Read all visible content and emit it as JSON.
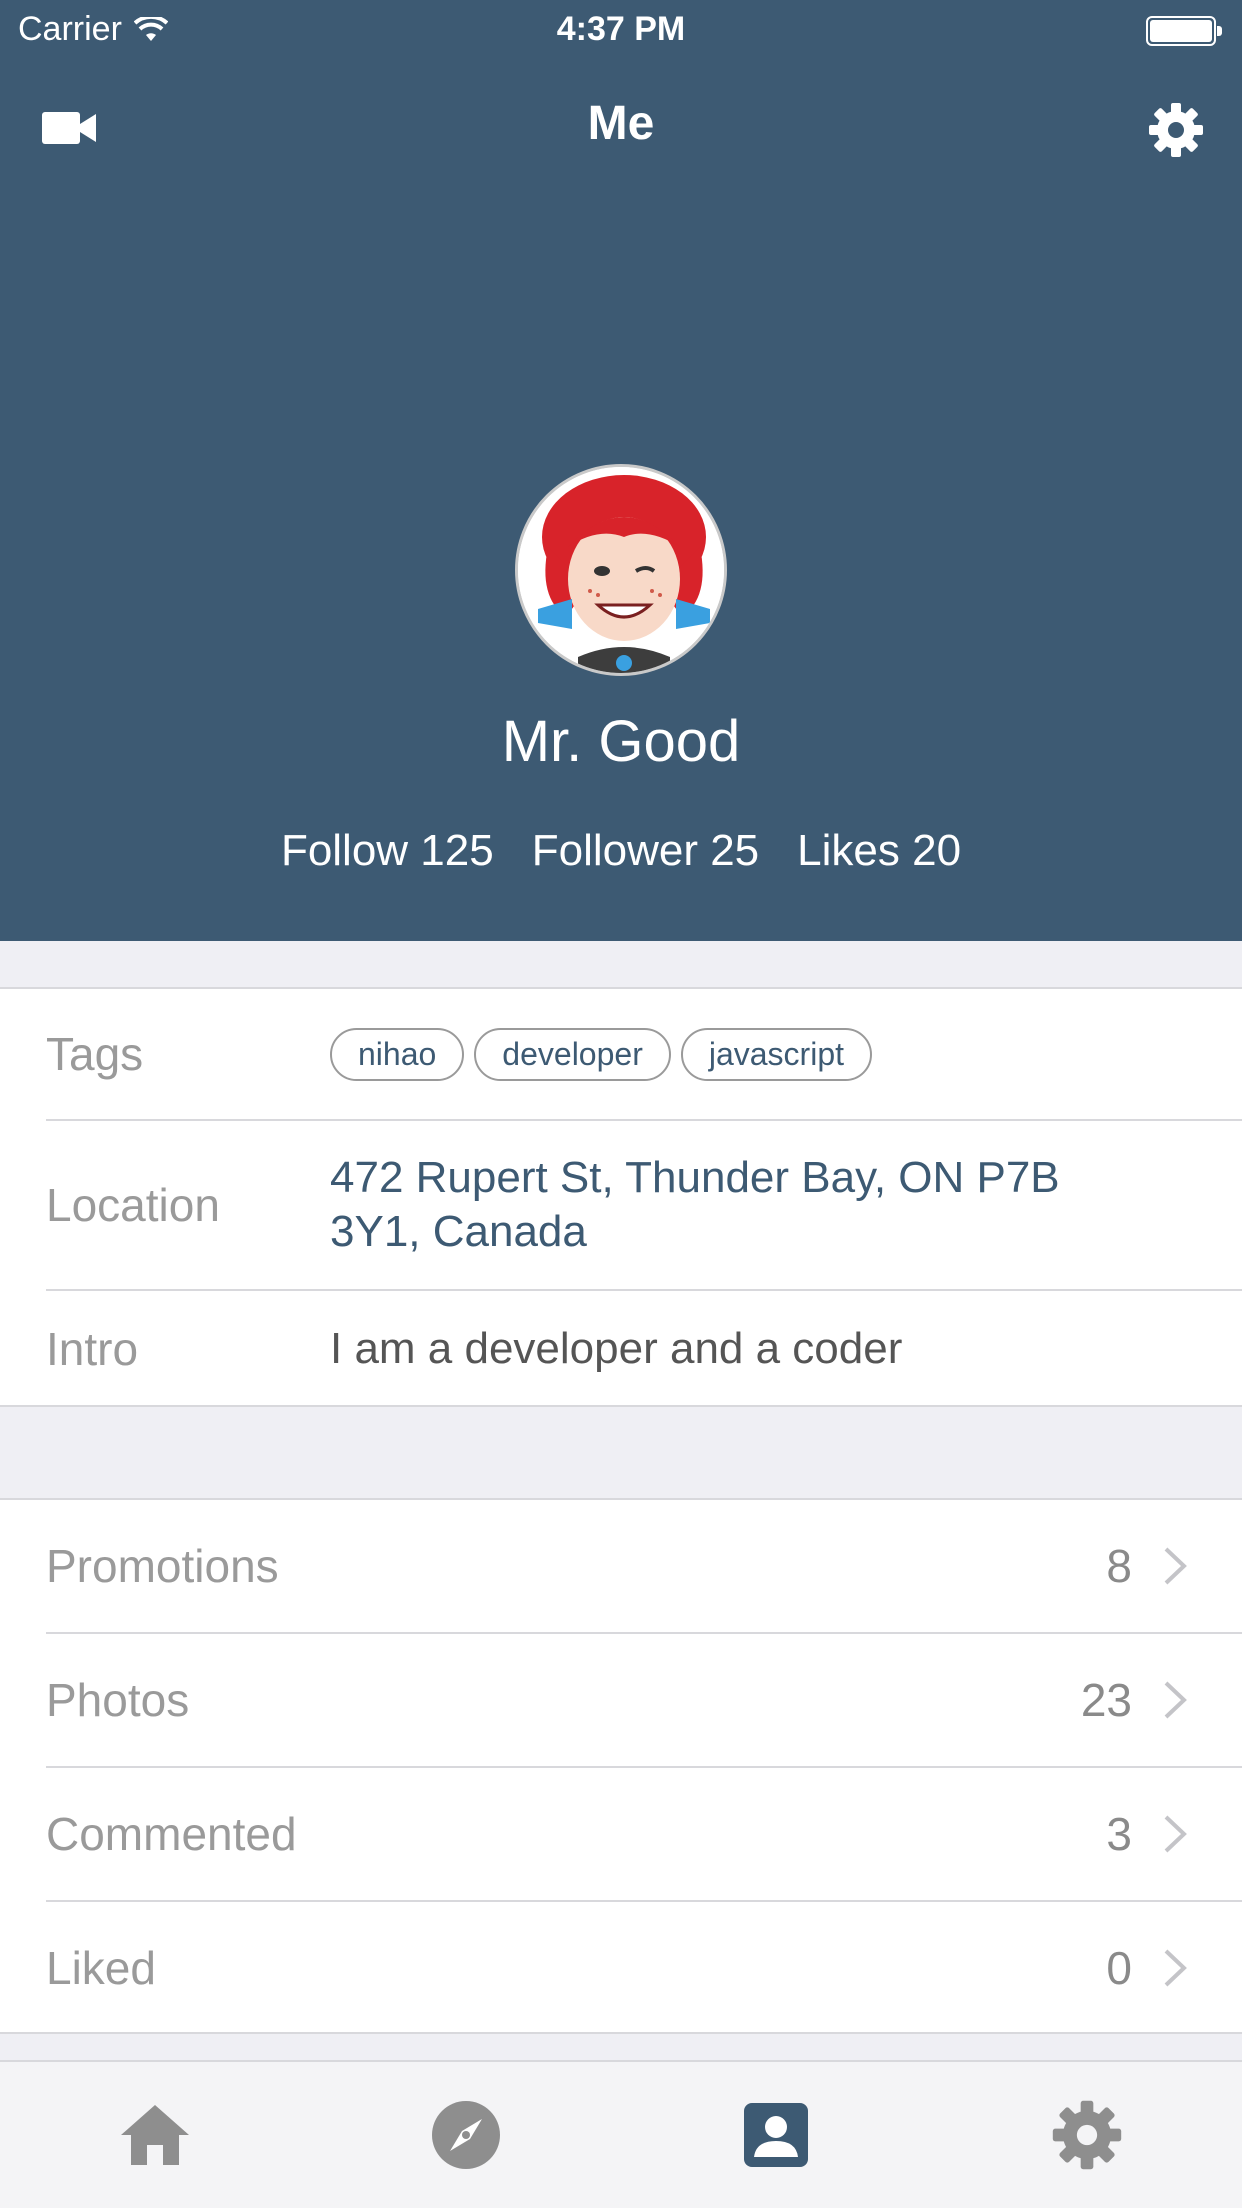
{
  "status_bar": {
    "carrier": "Carrier",
    "time": "4:37 PM"
  },
  "nav": {
    "title": "Me",
    "left_icon": "video-camera-icon",
    "right_icon": "gear-icon"
  },
  "profile": {
    "name": "Mr. Good",
    "stats": [
      {
        "label": "Follow 125"
      },
      {
        "label": "Follower 25"
      },
      {
        "label": "Likes 20"
      }
    ]
  },
  "info": {
    "tags_label": "Tags",
    "tags": [
      "nihao",
      "developer",
      "javascript"
    ],
    "location_label": "Location",
    "location_line1": "472 Rupert St, Thunder Bay, ON P7B",
    "location_line2": "3Y1, Canada",
    "intro_label": "Intro",
    "intro": "I am a developer and a coder"
  },
  "list": [
    {
      "label": "Promotions",
      "count": "8"
    },
    {
      "label": "Photos",
      "count": "23"
    },
    {
      "label": "Commented",
      "count": "3"
    },
    {
      "label": "Liked",
      "count": "0"
    }
  ],
  "tabbar": {
    "tabs": [
      {
        "icon": "home-icon",
        "active": false
      },
      {
        "icon": "compass-icon",
        "active": false
      },
      {
        "icon": "profile-icon",
        "active": true
      },
      {
        "icon": "settings-icon",
        "active": false
      }
    ]
  },
  "colors": {
    "header_bg": "#3d5a73",
    "accent": "#3d5a73",
    "label_gray": "#9a9a9a",
    "tab_inactive": "#8e8e8e"
  }
}
